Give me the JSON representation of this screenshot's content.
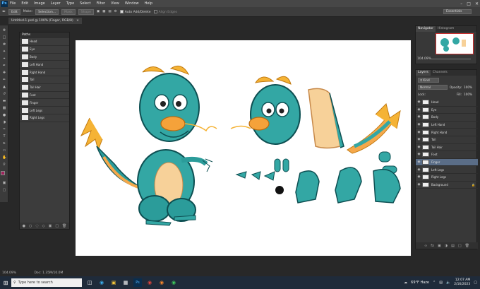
{
  "menubar": {
    "logo": "Ps",
    "items": [
      "File",
      "Edit",
      "Image",
      "Layer",
      "Type",
      "Select",
      "Filter",
      "View",
      "Window",
      "Help"
    ]
  },
  "options": {
    "edit_label": "Edit",
    "make_label": "Make:",
    "selection_btn": "Selection...",
    "mask_btn": "Mask",
    "shape_btn": "Shape",
    "auto_add_delete": "Auto Add/Delete",
    "align_edges": "Align Edges"
  },
  "workspace": "Essentials",
  "document": {
    "tab": "Untitled-1.psd @ 100% (Finger, RGB/8)"
  },
  "paths_panel": {
    "title": "Paths",
    "items": [
      "Head",
      "Eye",
      "Body",
      "Left Hand",
      "Right Hand",
      "Tail",
      "Tail Hair",
      "Foot",
      "Finger",
      "Left Legs",
      "Right Legs"
    ]
  },
  "status": {
    "zoom": "104.09%",
    "doc": "Doc: 1.35M/10.0M"
  },
  "navigator": {
    "tabs": [
      "Navigator",
      "Histogram"
    ],
    "zoom": "104.09%"
  },
  "layers_panel": {
    "tabs": [
      "Layers",
      "Channels"
    ],
    "kind": "Kind",
    "blend_mode": "Normal",
    "opacity_label": "Opacity:",
    "opacity": "100%",
    "lock_label": "Lock:",
    "fill_label": "Fill:",
    "fill": "100%",
    "layers": [
      "Head",
      "Eye",
      "Body",
      "Left Hand",
      "Right Hand",
      "Tail",
      "Tail Hair",
      "Foot",
      "Finger",
      "Left Legs",
      "Right Legs",
      "Background"
    ],
    "selected": "Finger"
  },
  "taskbar": {
    "search_placeholder": "Type here to search",
    "weather": "69°F Haze",
    "time": "12:07 AM",
    "date": "2/16/2023"
  }
}
